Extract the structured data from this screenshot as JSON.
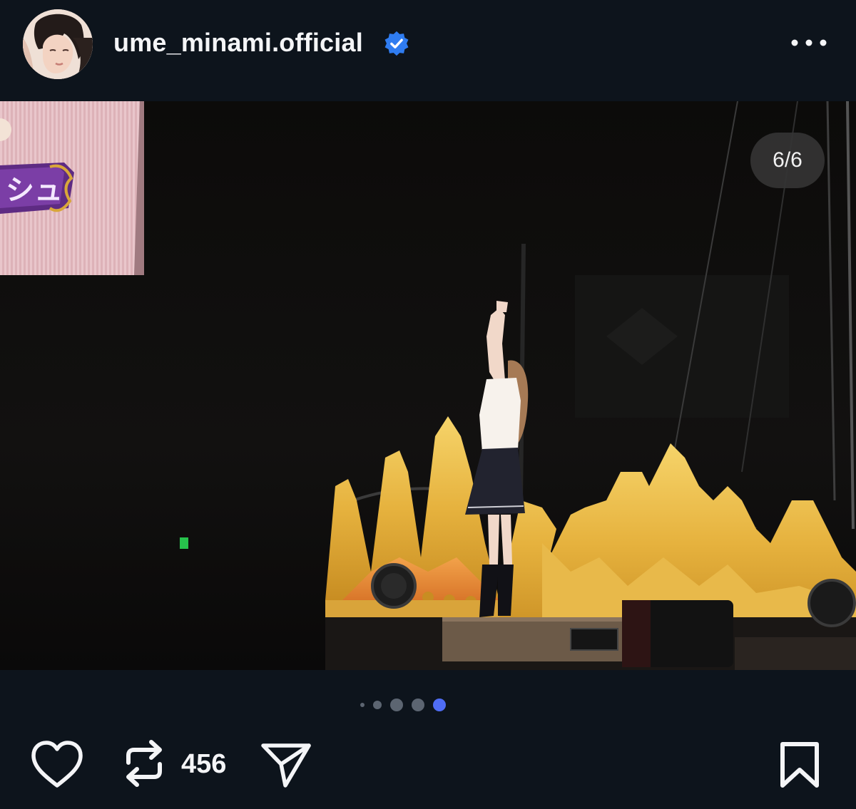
{
  "post": {
    "username": "ume_minami.official",
    "verified": true,
    "avatar_icon": "profile-photo",
    "more_icon": "more-horizontal-icon"
  },
  "media": {
    "counter": "6/6",
    "screen_text": "シュ",
    "current_index": 6,
    "total": 6
  },
  "carousel": {
    "dot_count": 5,
    "active_dot": 5,
    "active_color": "#4f6df5",
    "inactive_color": "#5c6571"
  },
  "actions": {
    "like_icon": "heart-icon",
    "repost_icon": "repost-icon",
    "repost_count": "456",
    "share_icon": "send-icon",
    "save_icon": "bookmark-icon"
  },
  "colors": {
    "background": "#0d141c",
    "verified_badge": "#2f7cf0"
  }
}
